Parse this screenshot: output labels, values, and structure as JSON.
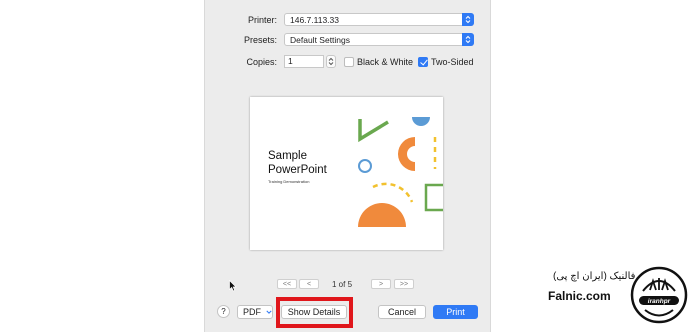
{
  "printer": {
    "label": "Printer:",
    "value": "146.7.113.33"
  },
  "presets": {
    "label": "Presets:",
    "value": "Default Settings"
  },
  "copies": {
    "label": "Copies:",
    "value": "1"
  },
  "options": {
    "black_white": {
      "label": "Black & White",
      "checked": false
    },
    "two_sided": {
      "label": "Two-Sided",
      "checked": true
    }
  },
  "slide": {
    "title_line1": "Sample",
    "title_line2": "PowerPoint",
    "subtitle": "Training Demonstration"
  },
  "pager": {
    "first": "<<",
    "prev": "<",
    "page_text": "1 of 5",
    "next": ">",
    "last": ">>"
  },
  "buttons": {
    "help": "?",
    "pdf": "PDF",
    "show_details": "Show Details",
    "cancel": "Cancel",
    "print": "Print"
  },
  "watermark": {
    "name_fa": "فالنیک (ایران اچ پی)",
    "name_en": "Falnic.com",
    "logo_text": "iranhpr"
  },
  "colors": {
    "accent": "#2f7af5",
    "highlight": "#e0161b",
    "shape_orange": "#f08a3c",
    "shape_green": "#6aa84f",
    "shape_blue": "#5b9bd5",
    "shape_yellow": "#f2c12e"
  }
}
